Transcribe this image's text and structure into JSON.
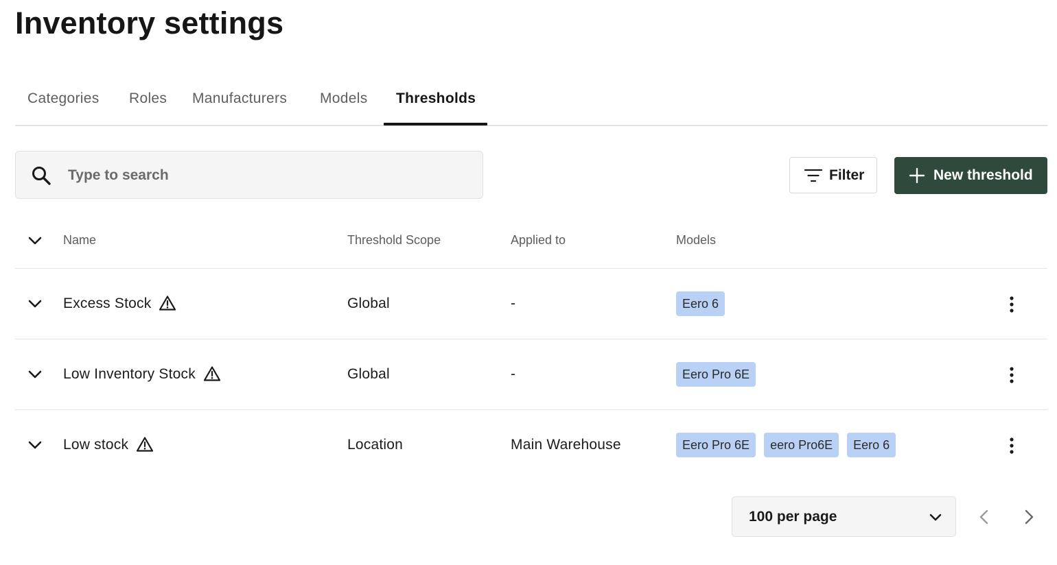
{
  "page": {
    "title": "Inventory settings"
  },
  "tabs": [
    {
      "label": "Categories",
      "active": false
    },
    {
      "label": "Roles",
      "active": false
    },
    {
      "label": "Manufacturers",
      "active": false
    },
    {
      "label": "Models",
      "active": false
    },
    {
      "label": "Thresholds",
      "active": true
    }
  ],
  "search": {
    "placeholder": "Type to search",
    "value": "",
    "icon": "search-icon"
  },
  "toolbar": {
    "filter_label": "Filter",
    "filter_icon": "filter-icon",
    "new_label": "New threshold",
    "new_icon": "plus-icon",
    "primary_color": "#2f4a3c"
  },
  "table": {
    "headers": {
      "name": "Name",
      "scope": "Threshold Scope",
      "applied": "Applied to",
      "models": "Models"
    },
    "rows": [
      {
        "name": "Excess Stock",
        "scope": "Global",
        "applied": "-",
        "models": [
          "Eero 6"
        ]
      },
      {
        "name": "Low Inventory Stock",
        "scope": "Global",
        "applied": "-",
        "models": [
          "Eero Pro 6E"
        ]
      },
      {
        "name": "Low stock",
        "scope": "Location",
        "applied": "Main Warehouse",
        "models": [
          "Eero Pro 6E",
          "eero Pro6E",
          "Eero 6"
        ]
      }
    ],
    "tag_color": "#b8d1f5"
  },
  "pagination": {
    "per_page_label": "100 per page"
  }
}
